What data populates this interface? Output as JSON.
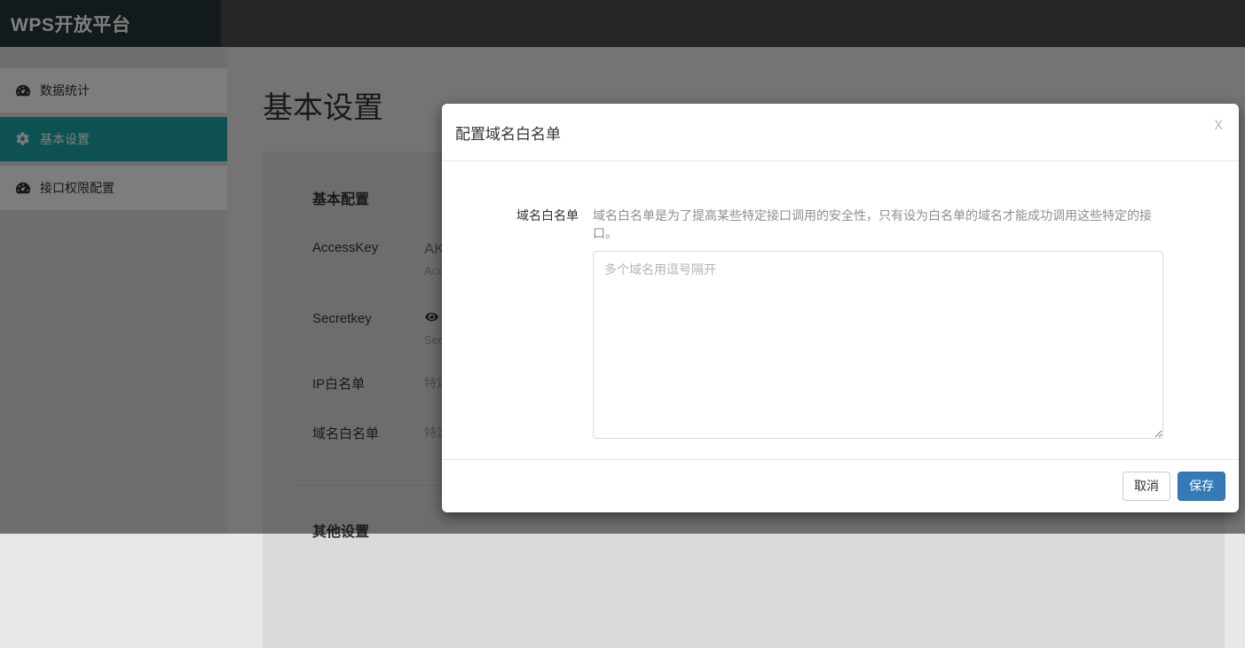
{
  "app": {
    "logo_text": "WPS开放平台"
  },
  "sidebar": {
    "items": [
      {
        "label": "数据统计",
        "icon": "dashboard-icon",
        "active": false
      },
      {
        "label": "基本设置",
        "icon": "gear-icon",
        "active": true
      },
      {
        "label": "接口权限配置",
        "icon": "dashboard-icon",
        "active": false
      }
    ]
  },
  "main": {
    "page_title": "基本设置",
    "card": {
      "section_title": "基本配置",
      "rows": [
        {
          "label": "AccessKey",
          "value": "AK",
          "sub": "Acc"
        },
        {
          "label": "Secretkey",
          "value_icon": "eye-icon",
          "sub": "Sec"
        },
        {
          "label": "IP白名单",
          "value": "特定"
        },
        {
          "label": "域名白名单",
          "value": "特定"
        }
      ],
      "section_title_2": "其他设置"
    }
  },
  "modal": {
    "title": "配置域名白名单",
    "close_label": "x",
    "field_label": "域名白名单",
    "hint": "域名白名单是为了提高某些特定接口调用的安全性，只有设为白名单的域名才能成功调用这些特定的接口。",
    "textarea_placeholder": "多个域名用逗号隔开",
    "textarea_value": "",
    "cancel_label": "取消",
    "save_label": "保存"
  },
  "colors": {
    "accent_teal": "#1aa2a6",
    "primary_blue": "#337ab7",
    "logo_bg": "#243438",
    "topbar_bg": "#4c4c4c"
  }
}
